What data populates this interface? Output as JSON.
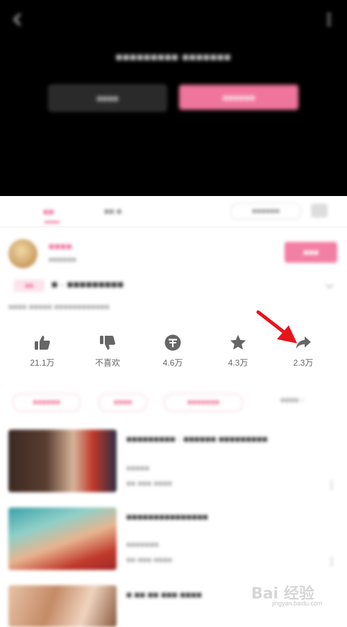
{
  "player": {
    "message": "■■■■■■■■■ ■■■■■■■",
    "left_button": "■■■■",
    "right_button": "■■■■■■"
  },
  "tabs": {
    "intro": "■■",
    "comments": "■■ ■",
    "danmaku_placeholder": "■■■■■■"
  },
  "uploader": {
    "name": "■■■■",
    "fans": "■■■■■■",
    "follow_label": "■■■"
  },
  "video": {
    "tag": "■■",
    "title": "■ · ■■■■■■■■■",
    "meta": "■■■■ ■■■■■ ■■■■■■■■■■■■"
  },
  "actions": [
    {
      "name": "like",
      "icon": "thumbs-up-icon",
      "count": "21.1万"
    },
    {
      "name": "dislike",
      "icon": "thumbs-down-icon",
      "count": "不喜欢"
    },
    {
      "name": "coin",
      "icon": "coin-icon",
      "count": "4.6万"
    },
    {
      "name": "favorite",
      "icon": "star-icon",
      "count": "4.3万"
    },
    {
      "name": "share",
      "icon": "share-icon",
      "count": "2.3万"
    }
  ],
  "annotation": {
    "color": "#e8141b"
  },
  "hashtags": {
    "items": [
      "■■■■■■",
      "■■■■",
      "■■■■■■■"
    ],
    "more": "■■■■ ›"
  },
  "related": [
    {
      "title": "■■■■■■■■■ · ■■■■■■ ■■■■■■■■■",
      "sub1": "■■■■■",
      "sub2": "■■ ■■■   ■■■■"
    },
    {
      "title": "■■■■■■■■■■■■■■■",
      "sub1": "■■■■■■■",
      "sub2": "■■ ■■■   ■■■■"
    },
    {
      "title": "■ ■■ ■■ ■■■ ■■■■"
    }
  ],
  "watermark": {
    "logo": "Bai 经验",
    "url": "jingyan.baidu.com"
  },
  "colors": {
    "accent": "#f0759c",
    "icon_gray": "#666666",
    "player_bg": "#000000"
  }
}
